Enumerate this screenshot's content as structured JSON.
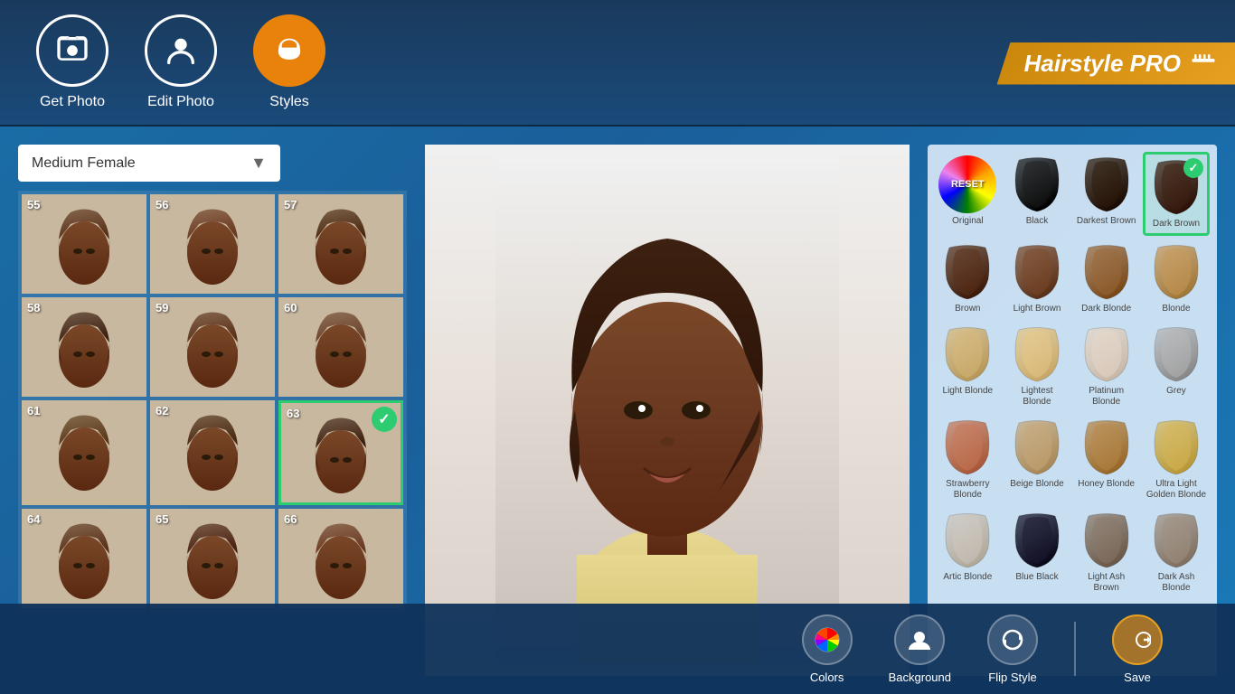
{
  "app": {
    "title": "Hairstyle PRO"
  },
  "header": {
    "nav_items": [
      {
        "id": "get-photo",
        "label": "Get Photo",
        "active": false,
        "icon": "camera"
      },
      {
        "id": "edit-photo",
        "label": "Edit Photo",
        "active": false,
        "icon": "person"
      },
      {
        "id": "styles",
        "label": "Styles",
        "active": true,
        "icon": "hair"
      }
    ]
  },
  "styles_panel": {
    "dropdown_label": "Medium Female",
    "items": [
      {
        "num": "55",
        "selected": false
      },
      {
        "num": "56",
        "selected": false
      },
      {
        "num": "57",
        "selected": false
      },
      {
        "num": "58",
        "selected": false
      },
      {
        "num": "59",
        "selected": false
      },
      {
        "num": "60",
        "selected": false
      },
      {
        "num": "61",
        "selected": false
      },
      {
        "num": "62",
        "selected": false
      },
      {
        "num": "63",
        "selected": true
      },
      {
        "num": "64",
        "selected": false
      },
      {
        "num": "65",
        "selected": false
      },
      {
        "num": "66",
        "selected": false
      }
    ]
  },
  "colors_panel": {
    "colors": [
      {
        "id": "original",
        "label": "Original",
        "type": "reset"
      },
      {
        "id": "black",
        "label": "Black",
        "hex": "#1a1a1a",
        "type": "dark"
      },
      {
        "id": "darkest-brown",
        "label": "Darkest Brown",
        "hex": "#2d1a0a",
        "type": "dark"
      },
      {
        "id": "dark-brown",
        "label": "Dark Brown",
        "hex": "#3d2010",
        "type": "dark",
        "selected": true
      },
      {
        "id": "brown",
        "label": "Brown",
        "hex": "#5a3018",
        "type": "medium"
      },
      {
        "id": "light-brown",
        "label": "Light Brown",
        "hex": "#7a4828",
        "type": "medium"
      },
      {
        "id": "dark-blonde",
        "label": "Dark Blonde",
        "hex": "#9a6838",
        "type": "medium"
      },
      {
        "id": "blonde",
        "label": "Blonde",
        "hex": "#c89858",
        "type": "light"
      },
      {
        "id": "light-blonde",
        "label": "Light Blonde",
        "hex": "#d8b878",
        "type": "light"
      },
      {
        "id": "lightest-blonde",
        "label": "Lightest Blonde",
        "hex": "#e8c888",
        "type": "light"
      },
      {
        "id": "platinum-blonde",
        "label": "Platinum Blonde",
        "hex": "#e8d8c8",
        "type": "light"
      },
      {
        "id": "grey",
        "label": "Grey",
        "hex": "#b8b8b8",
        "type": "light"
      },
      {
        "id": "strawberry-blonde",
        "label": "Strawberry Blonde",
        "hex": "#c87858",
        "type": "warm"
      },
      {
        "id": "beige-blonde",
        "label": "Beige Blonde",
        "hex": "#c8a878",
        "type": "warm"
      },
      {
        "id": "honey-blonde",
        "label": "Honey Blonde",
        "hex": "#b88848",
        "type": "warm"
      },
      {
        "id": "ultra-light-golden-blonde",
        "label": "Ultra Light Golden Blonde",
        "hex": "#d8b858",
        "type": "warm"
      },
      {
        "id": "artic-blonde",
        "label": "Artic Blonde",
        "hex": "#d0c8c0",
        "type": "ash"
      },
      {
        "id": "blue-black",
        "label": "Blue Black",
        "hex": "#1a1830",
        "type": "ash"
      },
      {
        "id": "light-ash-brown",
        "label": "Light Ash Brown",
        "hex": "#8a7868",
        "type": "ash"
      },
      {
        "id": "dark-ash-blonde",
        "label": "Dark Ash Blonde",
        "hex": "#a09080",
        "type": "ash"
      }
    ]
  },
  "toolbar": {
    "colors_label": "Colors",
    "background_label": "Background",
    "flip_style_label": "Flip Style",
    "save_label": "Save"
  }
}
